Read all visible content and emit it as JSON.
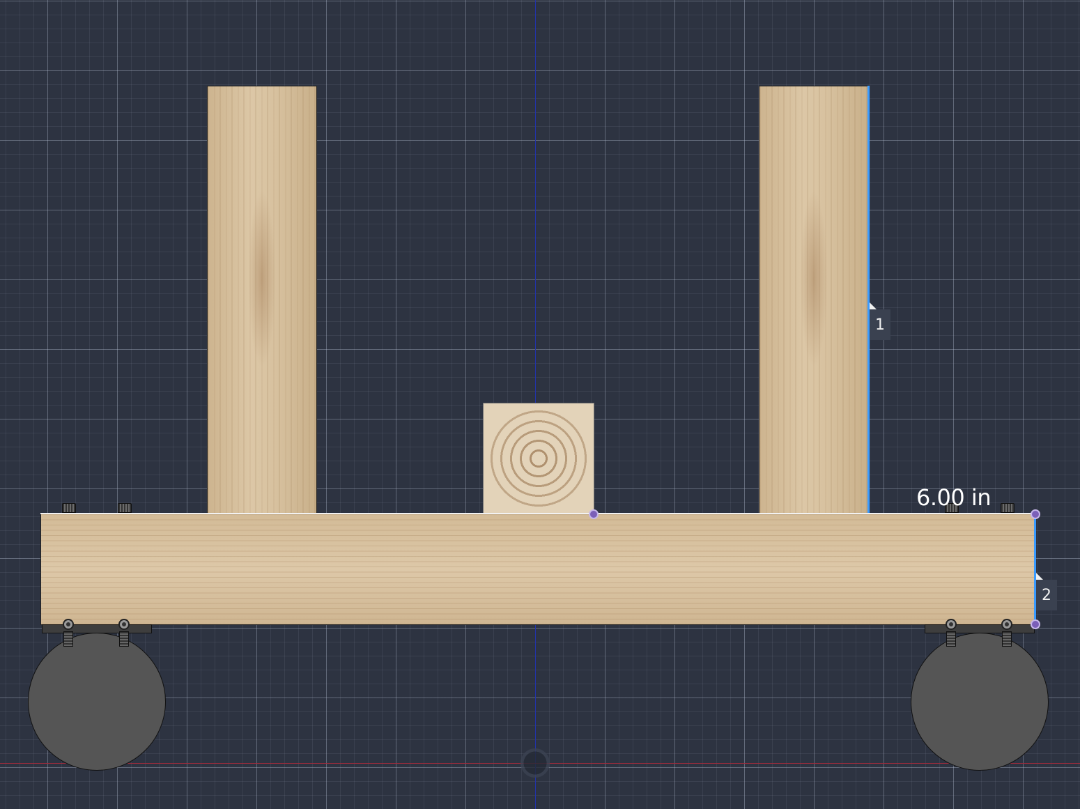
{
  "dimension": {
    "value_label": "6.00 in"
  },
  "constraint_tags": [
    {
      "label": "1"
    },
    {
      "label": "2"
    }
  ],
  "colors": {
    "background": "#2d3341",
    "grid": "#8a93a6",
    "vertical_axis": "#2233aa",
    "horizontal_axis": "#a12c3c",
    "selection": "#3a9bff",
    "handle": "#7b5fb8",
    "wheel": "#555555",
    "wood": "#d7c09e"
  }
}
